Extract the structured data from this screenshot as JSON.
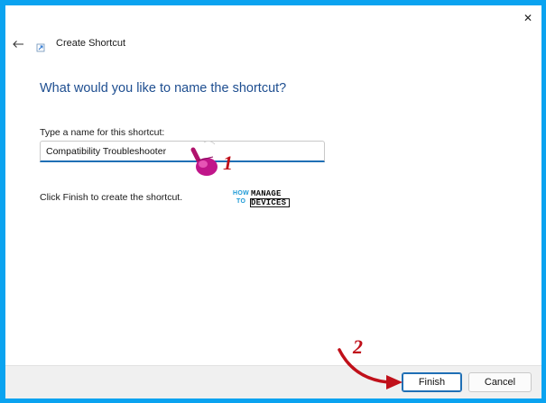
{
  "window": {
    "title": "Create Shortcut",
    "close_symbol": "✕",
    "back_symbol": "←"
  },
  "page": {
    "heading": "What would you like to name the shortcut?",
    "field_label": "Type a name for this shortcut:",
    "name_value": "Compatibility Troubleshooter",
    "hint": "Click Finish to create the shortcut."
  },
  "logo": {
    "how": "HOW",
    "to": "TO",
    "manage": "MANAGE",
    "devices": "DEVICES"
  },
  "buttons": {
    "finish": "Finish",
    "cancel": "Cancel"
  },
  "annotations": {
    "step1": "1",
    "step2": "2"
  },
  "colors": {
    "frame_border": "#0aa3f0",
    "heading": "#1e4e90",
    "accent": "#1f6fb5",
    "annotation": "#c0101a",
    "footer": "#f0f0f0"
  },
  "icons": {
    "close": "close-icon",
    "back": "back-arrow-icon",
    "wizard": "shortcut-wizard-icon",
    "pointer": "hand-pointer-icon",
    "callout_arrow": "curved-arrow-icon"
  }
}
